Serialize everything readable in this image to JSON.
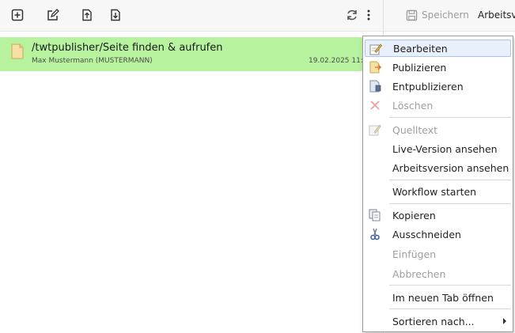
{
  "toolbar": {
    "icons": [
      "new-icon",
      "edit-icon",
      "upload-icon",
      "download-icon",
      "refresh-icon",
      "more-vertical-icon"
    ]
  },
  "list": {
    "selected_item": {
      "title": "/twtpublisher/Seite finden & aufrufen",
      "author": "Max Mustermann (MUSTERMANN)",
      "date": "19.02.2025 11:",
      "highlight_color": "#b7f29e"
    }
  },
  "editor": {
    "save_label": "Speichern",
    "version_label": "Arbeitsve"
  },
  "context_menu": {
    "items": [
      {
        "label": "Bearbeiten",
        "icon": "edit-pencil-icon",
        "enabled": true,
        "highlighted": true
      },
      {
        "label": "Publizieren",
        "icon": "publish-icon",
        "enabled": true
      },
      {
        "label": "Entpublizieren",
        "icon": "unpublish-icon",
        "enabled": true
      },
      {
        "label": "Löschen",
        "icon": "delete-x-icon",
        "enabled": false
      },
      {
        "label": "Quelltext",
        "icon": "source-icon",
        "enabled": false
      },
      {
        "label": "Live-Version ansehen",
        "enabled": true
      },
      {
        "label": "Arbeitsversion ansehen",
        "enabled": true
      },
      {
        "label": "Workflow starten",
        "enabled": true
      },
      {
        "label": "Kopieren",
        "icon": "copy-icon",
        "enabled": true
      },
      {
        "label": "Ausschneiden",
        "icon": "scissors-icon",
        "enabled": true
      },
      {
        "label": "Einfügen",
        "enabled": false
      },
      {
        "label": "Abbrechen",
        "enabled": false
      },
      {
        "label": "Im neuen Tab öffnen",
        "enabled": true
      },
      {
        "label": "Sortieren nach...",
        "enabled": true,
        "submenu": true
      }
    ]
  },
  "colors": {
    "accent_highlight": "#b7f29e",
    "menu_hover": "#e8f0fb",
    "disabled_text": "#9e9e9e"
  }
}
